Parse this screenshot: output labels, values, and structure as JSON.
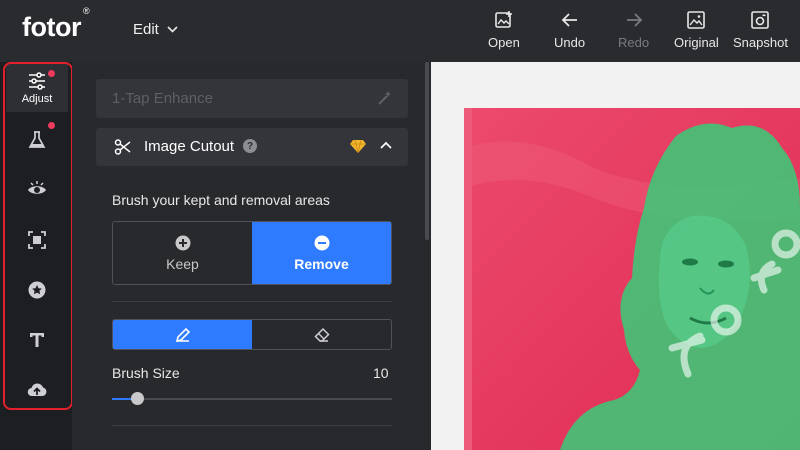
{
  "app": {
    "logo": "fotor",
    "logo_mark": "®"
  },
  "header": {
    "edit_menu": "Edit",
    "toolbar": [
      {
        "id": "open",
        "label": "Open",
        "icon": "add-image-icon",
        "enabled": true
      },
      {
        "id": "undo",
        "label": "Undo",
        "icon": "arrow-left-icon",
        "enabled": true
      },
      {
        "id": "redo",
        "label": "Redo",
        "icon": "arrow-right-icon",
        "enabled": false
      },
      {
        "id": "original",
        "label": "Original",
        "icon": "image-icon",
        "enabled": true
      },
      {
        "id": "snapshot",
        "label": "Snapshot",
        "icon": "camera-icon",
        "enabled": true
      }
    ]
  },
  "sidebar": {
    "items": [
      {
        "id": "adjust",
        "label": "Adjust",
        "icon": "sliders-icon",
        "active": true,
        "badge": true
      },
      {
        "id": "effects",
        "icon": "flask-icon",
        "active": false,
        "badge": true
      },
      {
        "id": "beauty",
        "icon": "eye-icon",
        "active": false,
        "badge": false
      },
      {
        "id": "frames",
        "icon": "frame-icon",
        "active": false,
        "badge": false
      },
      {
        "id": "stickers",
        "icon": "star-icon",
        "active": false,
        "badge": false
      },
      {
        "id": "text",
        "icon": "text-icon",
        "active": false,
        "badge": false
      },
      {
        "id": "upload",
        "icon": "cloud-upload-icon",
        "active": false,
        "badge": false
      }
    ]
  },
  "panel": {
    "enhance_label": "1-Tap Enhance",
    "cutout": {
      "title": "Image Cutout",
      "help": "?",
      "instruction": "Brush your kept and removal areas",
      "keep_label": "Keep",
      "remove_label": "Remove",
      "selected_mode": "remove",
      "selected_tool": "brush",
      "brush_size_label": "Brush Size",
      "brush_size_value": "10",
      "brush_size_fraction": 0.09
    }
  },
  "colors": {
    "accent": "#2f7bff",
    "highlight_outline": "#e3202d",
    "badge": "#ef3b5b",
    "photo_background": "#e93a63",
    "keep_overlay": "#3cc878"
  }
}
